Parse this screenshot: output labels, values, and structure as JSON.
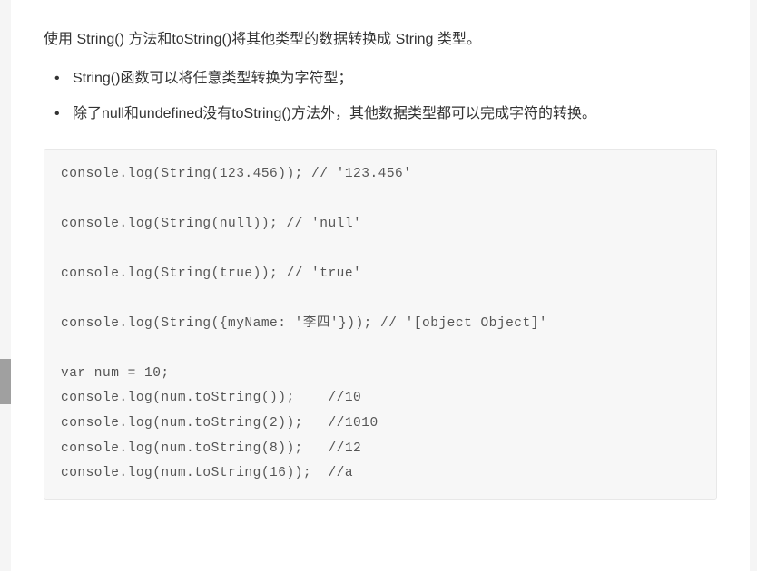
{
  "intro": "使用 String() 方法和toString()将其他类型的数据转换成 String 类型。",
  "bullets": [
    "String()函数可以将任意类型转换为字符型；",
    "除了null和undefined没有toString()方法外，其他数据类型都可以完成字符的转换。"
  ],
  "code": "console.log(String(123.456)); // '123.456'\n\nconsole.log(String(null)); // 'null'\n\nconsole.log(String(true)); // 'true'\n\nconsole.log(String({myName: '李四'})); // '[object Object]'\n\nvar num = 10;\nconsole.log(num.toString());    //10\nconsole.log(num.toString(2));   //1010\nconsole.log(num.toString(8));   //12\nconsole.log(num.toString(16));  //a"
}
